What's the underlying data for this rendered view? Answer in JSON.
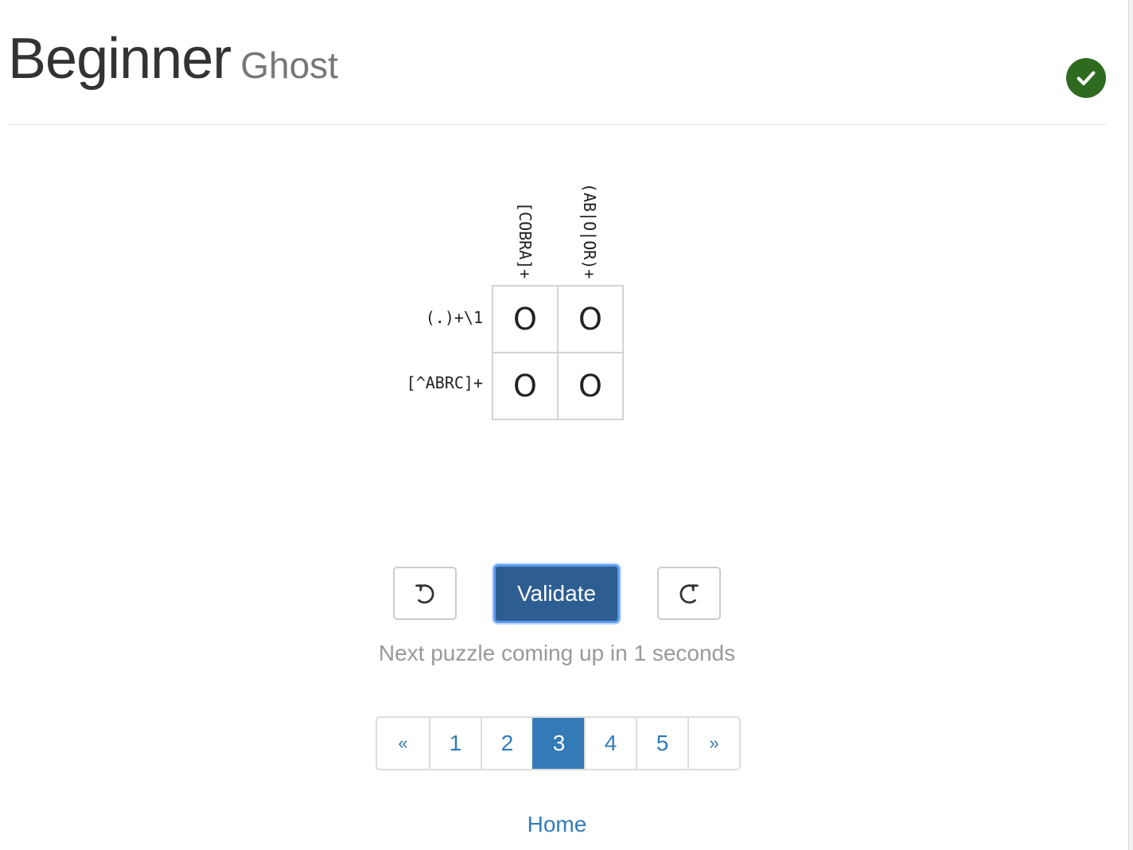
{
  "header": {
    "title": "Beginner",
    "subtitle": "Ghost"
  },
  "status": {
    "solved_icon": "check-circle-icon",
    "color": "#2e6b1f"
  },
  "puzzle": {
    "column_clues": [
      "[COBRA]+",
      "(AB|O|OR)+"
    ],
    "row_clues": [
      "(.)+\\1",
      "[^ABRC]+"
    ],
    "cells": [
      [
        "O",
        "O"
      ],
      [
        "O",
        "O"
      ]
    ]
  },
  "controls": {
    "undo_icon": "undo-icon",
    "validate_label": "Validate",
    "redo_icon": "redo-icon"
  },
  "countdown_text": "Next puzzle coming up in 1 seconds",
  "pagination": {
    "prev": "«",
    "pages": [
      "1",
      "2",
      "3",
      "4",
      "5"
    ],
    "current": "3",
    "next": "»"
  },
  "footer": {
    "home_link": "Home"
  },
  "colors": {
    "accent": "#337ab7",
    "validate_bg": "#2d5d91"
  }
}
